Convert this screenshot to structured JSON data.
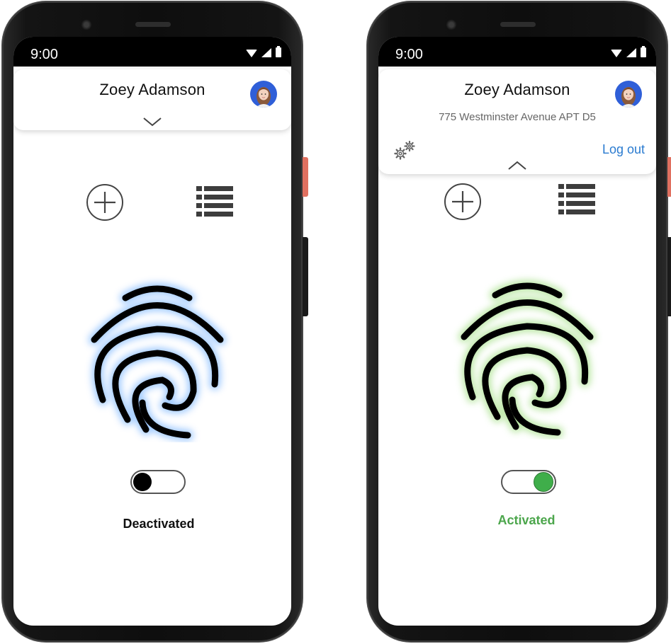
{
  "colors": {
    "glow_deactivated": "#9cc8ff",
    "glow_activated": "#b8e6a0",
    "activated_text": "#4ca64c",
    "logout_link": "#2a7bd0",
    "avatar_bg": "#2f5fd8"
  },
  "left_phone": {
    "status_bar": {
      "time": "9:00"
    },
    "header": {
      "user_name": "Zoey Adamson",
      "expanded": false
    },
    "actions": {
      "add_icon": "plus-circle-icon",
      "list_icon": "list-icon"
    },
    "fingerprint_icon": "fingerprint-icon",
    "toggle": {
      "on": false
    },
    "status_label": "Deactivated"
  },
  "right_phone": {
    "status_bar": {
      "time": "9:00"
    },
    "header": {
      "user_name": "Zoey Adamson",
      "address": "775 Westminster Avenue APT D5",
      "logout_label": "Log out",
      "settings_icon": "gears-icon",
      "expanded": true
    },
    "actions": {
      "add_icon": "plus-circle-icon",
      "list_icon": "list-icon"
    },
    "fingerprint_icon": "fingerprint-icon",
    "toggle": {
      "on": true
    },
    "status_label": "Activated"
  }
}
